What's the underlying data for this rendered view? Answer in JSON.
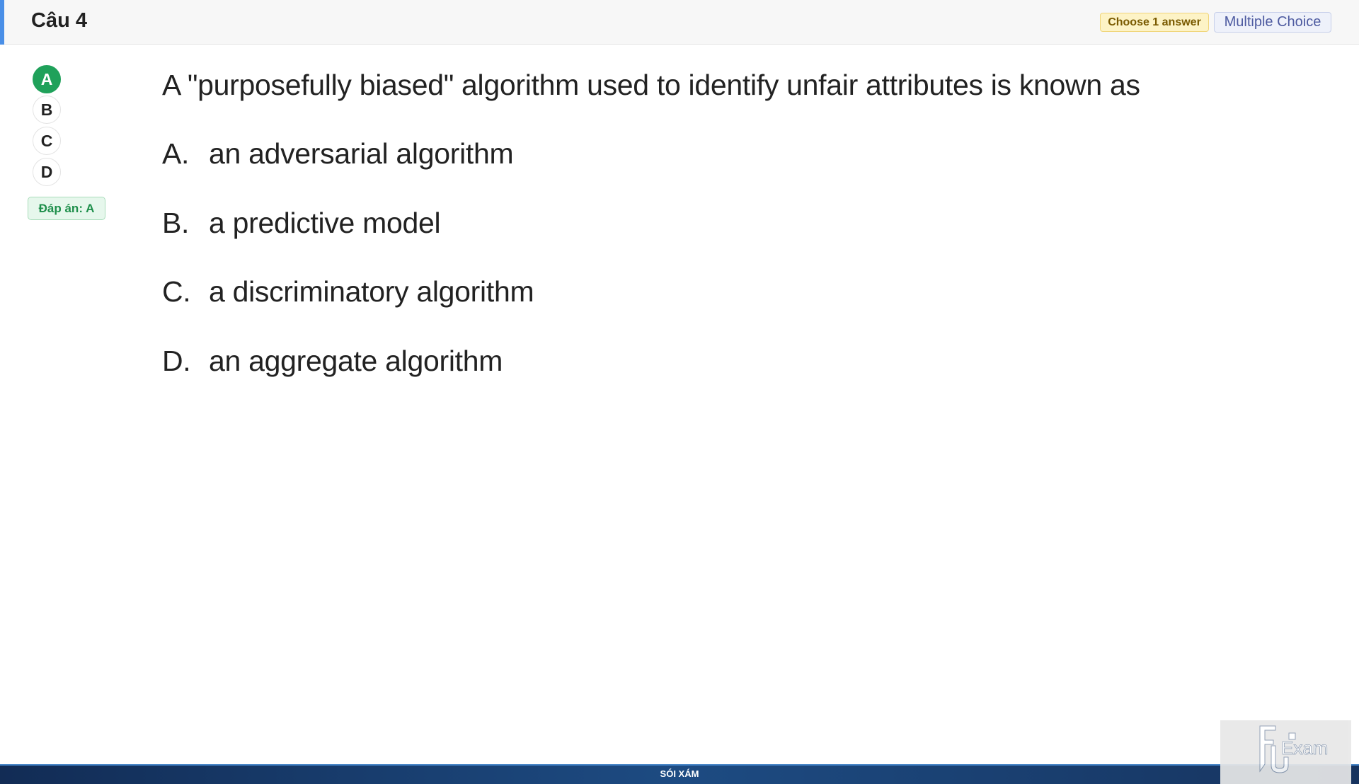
{
  "header": {
    "title": "Câu 4",
    "choose_badge": "Choose 1 answer",
    "type_badge": "Multiple Choice"
  },
  "options_nav": {
    "items": [
      "A",
      "B",
      "C",
      "D"
    ],
    "selected": "A",
    "answer_label": "Đáp án: A"
  },
  "question": {
    "text": "A \"purposefully biased\" algorithm used to identify unfair attributes is known as",
    "choices": [
      {
        "letter": "A.",
        "text": "an adversarial algorithm"
      },
      {
        "letter": "B.",
        "text": "a predictive model"
      },
      {
        "letter": "C.",
        "text": "a discriminatory algorithm"
      },
      {
        "letter": "D.",
        "text": "an aggregate algorithm"
      }
    ]
  },
  "footer": {
    "text": "SÓI XÁM"
  },
  "watermark": {
    "text": "FU Exam"
  },
  "colors": {
    "accent": "#4a8fe7",
    "selected_green": "#1fa15a",
    "footer_blue": "#1d4b82"
  }
}
